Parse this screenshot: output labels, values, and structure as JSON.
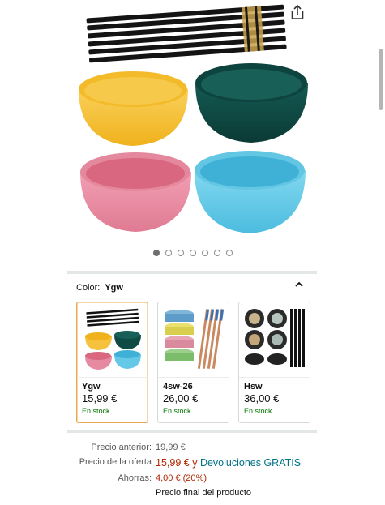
{
  "gallery": {
    "image_alt": "",
    "dot_count": 7,
    "active_index": 0
  },
  "variation": {
    "label": "Color:",
    "selected": "Ygw"
  },
  "options": [
    {
      "name": "Ygw",
      "price": "15,99 €",
      "stock": "En stock.",
      "selected": true
    },
    {
      "name": "4sw-26",
      "price": "26,00 €",
      "stock": "En stock.",
      "selected": false
    },
    {
      "name": "Hsw",
      "price": "36,00 €",
      "stock": "En stock.",
      "selected": false
    }
  ],
  "pricing": {
    "previous_label": "Precio anterior:",
    "previous_value": "19,99 €",
    "offer_label": "Precio de la oferta",
    "offer_value": "15,99 €",
    "offer_connector": "y",
    "returns_link": "Devoluciones GRATIS",
    "savings_label": "Ahorras:",
    "savings_value": "4,00 € (20%)",
    "final_note": "Precio final del producto"
  },
  "colors": {
    "offer_red": "#b12704",
    "link_teal": "#007185",
    "stock_green": "#007600",
    "selected_border": "#e7a855",
    "bowl_yellow": "#f6c23e",
    "bowl_green": "#0f4a44",
    "bowl_pink": "#e58aa0",
    "bowl_blue": "#63c9e6"
  },
  "icons": {
    "share": "share-icon",
    "collapse": "chevron-up-icon"
  }
}
